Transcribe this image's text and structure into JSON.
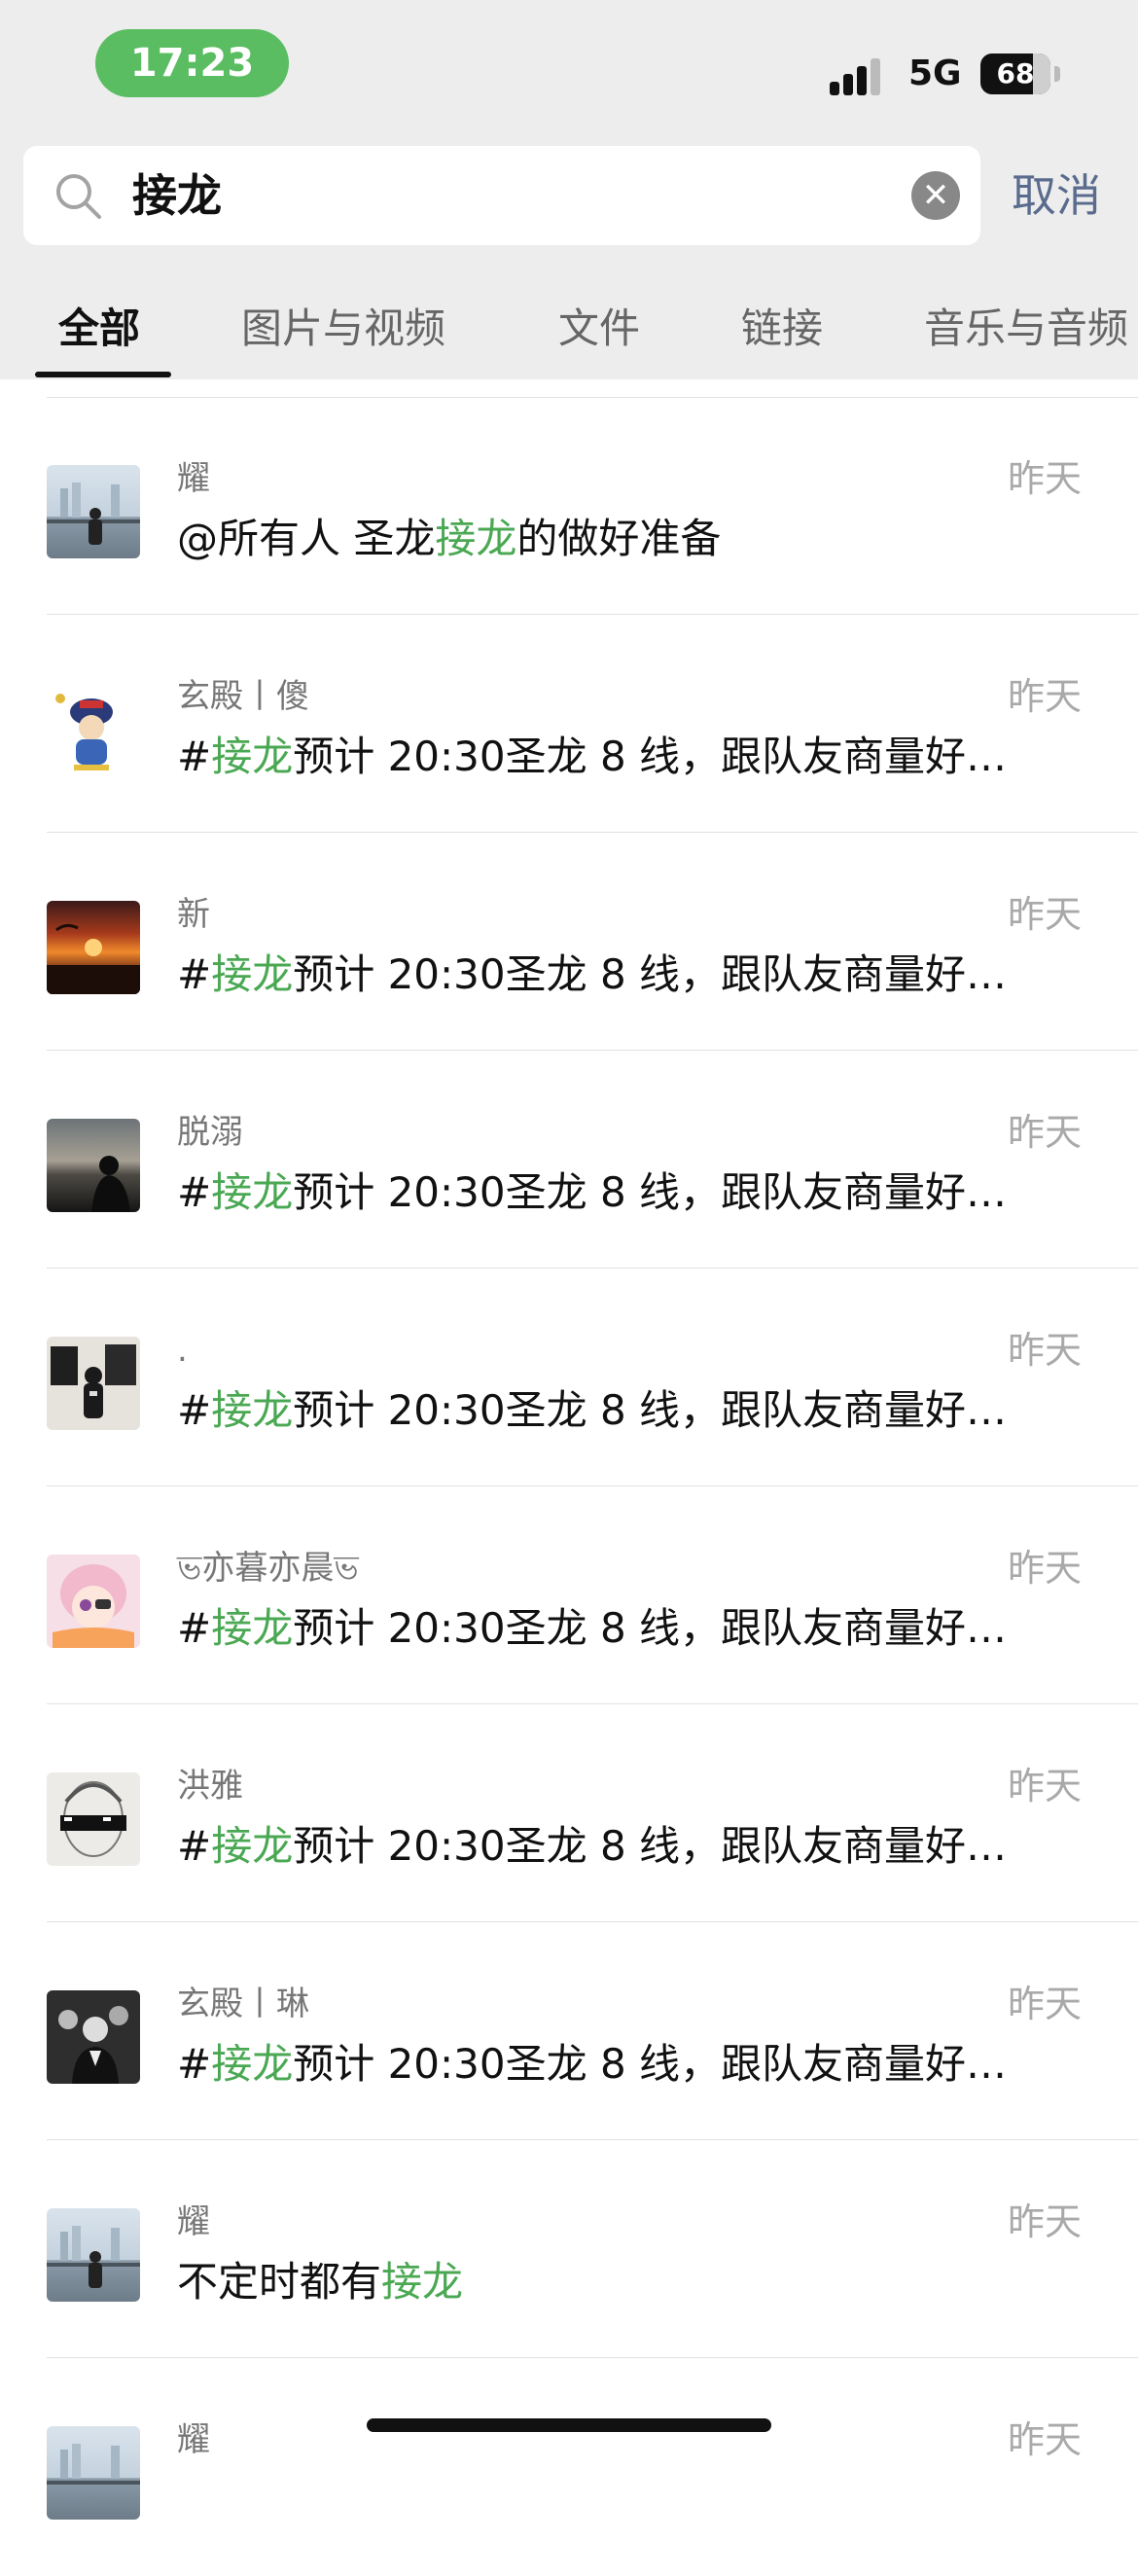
{
  "status_bar": {
    "time": "17:23",
    "network": "5G",
    "battery": "68"
  },
  "search": {
    "query": "接龙",
    "cancel_label": "取消"
  },
  "tabs": [
    {
      "label": "全部",
      "active": true
    },
    {
      "label": "图片与视频",
      "active": false
    },
    {
      "label": "文件",
      "active": false
    },
    {
      "label": "链接",
      "active": false
    },
    {
      "label": "音乐与音频",
      "active": false
    }
  ],
  "highlight_color": "#4aa853",
  "results": [
    {
      "sender": "耀",
      "date": "昨天",
      "pre": "@所有人 圣龙",
      "hl": "接龙",
      "post": "的做好准备",
      "avatar": "city-waterfront"
    },
    {
      "sender": "玄殿丨傻",
      "date": "昨天",
      "pre": "#",
      "hl": "接龙",
      "post": "预计 20:30圣龙 8 线，跟队友商量好…",
      "avatar": "cartoon-qing-figure"
    },
    {
      "sender": "新",
      "date": "昨天",
      "pre": "#",
      "hl": "接龙",
      "post": "预计 20:30圣龙 8 线，跟队友商量好…",
      "avatar": "sunset"
    },
    {
      "sender": "脱溺",
      "date": "昨天",
      "pre": "#",
      "hl": "接龙",
      "post": "预计 20:30圣龙 8 线，跟队友商量好…",
      "avatar": "dusk-silhouette"
    },
    {
      "sender": ".",
      "date": "昨天",
      "pre": "#",
      "hl": "接龙",
      "post": "预计 20:30圣龙 8 线，跟队友商量好…",
      "avatar": "gallery"
    },
    {
      "sender": "ভ亦暮亦晨ভ",
      "date": "昨天",
      "pre": "#",
      "hl": "接龙",
      "post": "预计 20:30圣龙 8 线，跟队友商量好…",
      "avatar": "anime-girl"
    },
    {
      "sender": "洪雅",
      "date": "昨天",
      "pre": "#",
      "hl": "接龙",
      "post": "预计 20:30圣龙 8 线，跟队友商量好…",
      "avatar": "sketch-sunglasses"
    },
    {
      "sender": "玄殿丨琳",
      "date": "昨天",
      "pre": "#",
      "hl": "接龙",
      "post": "预计 20:30圣龙 8 线，跟队友商量好…",
      "avatar": "bw-crowd"
    },
    {
      "sender": "耀",
      "date": "昨天",
      "pre": "不定时都有",
      "hl": "接龙",
      "post": "",
      "avatar": "city-waterfront"
    },
    {
      "sender": "耀",
      "date": "昨天",
      "pre": "",
      "hl": "",
      "post": "",
      "avatar": "city-waterfront"
    }
  ]
}
